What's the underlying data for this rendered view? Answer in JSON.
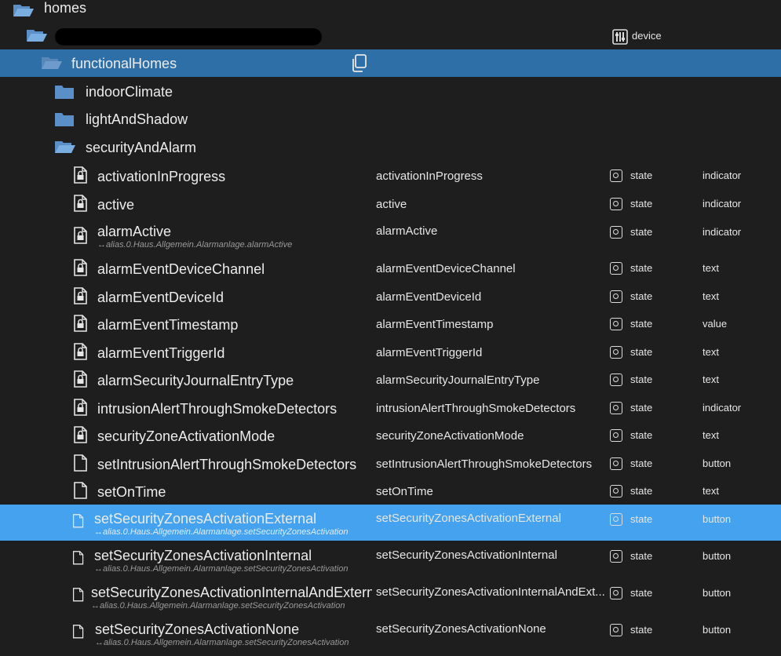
{
  "tree": {
    "root": {
      "label": "homes"
    },
    "device_row": {
      "type_label": "device",
      "icon": "device-icon"
    },
    "functional": {
      "label": "functionalHomes",
      "action_icon": "copy-icon"
    },
    "folders": [
      {
        "label": "indoorClimate",
        "icon": "folder-icon"
      },
      {
        "label": "lightAndShadow",
        "icon": "folder-icon"
      },
      {
        "label": "securityAndAlarm",
        "icon": "folder-open-icon"
      }
    ],
    "states": [
      {
        "name": "activationInProgress",
        "alias": "",
        "id": "activationInProgress",
        "type": "state",
        "role": "indicator"
      },
      {
        "name": "active",
        "alias": "",
        "id": "active",
        "type": "state",
        "role": "indicator"
      },
      {
        "name": "alarmActive",
        "alias": "↔alias.0.Haus.Allgemein.Alarmanlage.alarmActive",
        "id": "alarmActive",
        "type": "state",
        "role": "indicator"
      },
      {
        "name": "alarmEventDeviceChannel",
        "alias": "",
        "id": "alarmEventDeviceChannel",
        "type": "state",
        "role": "text"
      },
      {
        "name": "alarmEventDeviceId",
        "alias": "",
        "id": "alarmEventDeviceId",
        "type": "state",
        "role": "text"
      },
      {
        "name": "alarmEventTimestamp",
        "alias": "",
        "id": "alarmEventTimestamp",
        "type": "state",
        "role": "value"
      },
      {
        "name": "alarmEventTriggerId",
        "alias": "",
        "id": "alarmEventTriggerId",
        "type": "state",
        "role": "text"
      },
      {
        "name": "alarmSecurityJournalEntryType",
        "alias": "",
        "id": "alarmSecurityJournalEntryType",
        "type": "state",
        "role": "text"
      },
      {
        "name": "intrusionAlertThroughSmokeDetectors",
        "alias": "",
        "id": "intrusionAlertThroughSmokeDetectors",
        "type": "state",
        "role": "indicator"
      },
      {
        "name": "securityZoneActivationMode",
        "alias": "",
        "id": "securityZoneActivationMode",
        "type": "state",
        "role": "text"
      },
      {
        "name": "setIntrusionAlertThroughSmokeDetectors",
        "alias": "",
        "id": "setIntrusionAlertThroughSmokeDetectors",
        "type": "state",
        "role": "button"
      },
      {
        "name": "setOnTime",
        "alias": "",
        "id": "setOnTime",
        "type": "state",
        "role": "text"
      },
      {
        "name": "setSecurityZonesActivationExternal",
        "alias": "↔alias.0.Haus.Allgemein.Alarmanlage.setSecurityZonesActivation",
        "id": "setSecurityZonesActivationExternal",
        "type": "state",
        "role": "button"
      },
      {
        "name": "setSecurityZonesActivationInternal",
        "alias": "↔alias.0.Haus.Allgemein.Alarmanlage.setSecurityZonesActivation",
        "id": "setSecurityZonesActivationInternal",
        "type": "state",
        "role": "button"
      },
      {
        "name": "setSecurityZonesActivationInternalAndExterna",
        "alias": "↔alias.0.Haus.Allgemein.Alarmanlage.setSecurityZonesActivation",
        "id": "setSecurityZonesActivationInternalAndExt...",
        "type": "state",
        "role": "button"
      },
      {
        "name": "setSecurityZonesActivationNone",
        "alias": "↔alias.0.Haus.Allgemein.Alarmanlage.setSecurityZonesActivation",
        "id": "setSecurityZonesActivationNone",
        "type": "state",
        "role": "button"
      }
    ]
  },
  "colors": {
    "background": "#1e1e1e",
    "selected_dark": "#2f6fa7",
    "selected_light": "#44a2ee",
    "folder": "#5b8fc7"
  }
}
